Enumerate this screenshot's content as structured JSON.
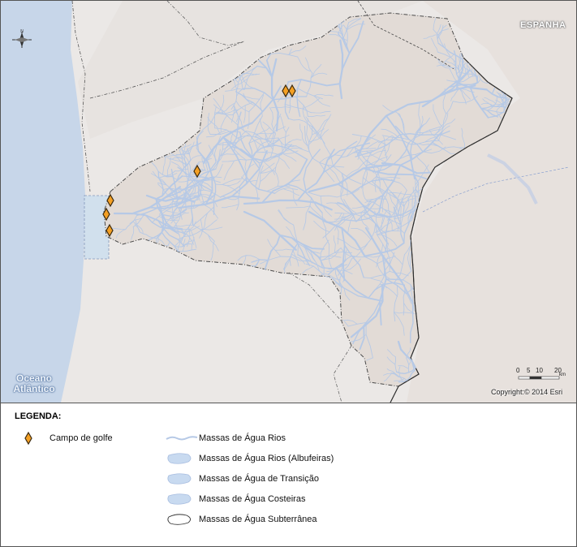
{
  "map": {
    "labels": {
      "country": "ESPANHA",
      "ocean_line1": "Oceano",
      "ocean_line2": "Atlântico"
    },
    "north_arrow": {
      "letter": "N"
    },
    "scale_bar": {
      "ticks": [
        "0",
        "5",
        "10",
        "20"
      ],
      "unit": "km"
    },
    "copyright": "Copyright:© 2014 Esri",
    "colors": {
      "ocean": "#c7d6e9",
      "land": "#e9e6e4",
      "basin": "#e3dcd7",
      "river": "#b9cbe6",
      "golf_fill": "#f4a024",
      "golf_stroke": "#3b2a10"
    },
    "golf_course_count": 6
  },
  "legend": {
    "title": "LEGENDA:",
    "items": [
      {
        "symbol": "golf-diamond",
        "label": "Campo de golfe"
      },
      {
        "symbol": "river-line",
        "label": "Massas de Água Rios"
      },
      {
        "symbol": "reservoir-blob",
        "label": "Massas de Água Rios (Albufeiras)"
      },
      {
        "symbol": "transition-blob",
        "label": "Massas de Água de Transição"
      },
      {
        "symbol": "coastal-blob",
        "label": "Massas de Água Costeiras"
      },
      {
        "symbol": "groundwater-outline",
        "label": "Massas de Água Subterrânea"
      }
    ]
  }
}
